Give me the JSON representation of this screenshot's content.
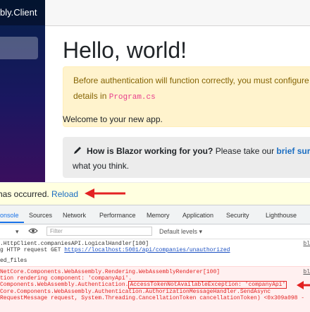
{
  "app": {
    "brand": "bly.Client",
    "heading": "Hello, world!",
    "alert": {
      "line1": "Before authentication will function correctly, you must configure",
      "line2_prefix": "details in",
      "line2_code": "Program.cs"
    },
    "welcome": "Welcome to your new app.",
    "survey": {
      "question": "How is Blazor working for you?",
      "prompt": "Please take our",
      "link": "brief sur",
      "line2": "what you think."
    }
  },
  "error_ui": {
    "message": "has occurred.",
    "reload": "Reload"
  },
  "devtools": {
    "tabs": [
      "onsole",
      "Sources",
      "Network",
      "Performance",
      "Memory",
      "Application",
      "Security",
      "Lighthouse"
    ],
    "active_tab": "onsole",
    "toolbar": {
      "filter_placeholder": "Filter",
      "levels": "Default levels ▾",
      "context": "▾"
    },
    "logs": {
      "info": [
        ".HttpClient.companiesAPI.LogicalHandler[100]",
        "g HTTP request GET",
        "https://localhost:5001/api/companies/unauthorized",
        "ed_files"
      ],
      "info_src": "bl",
      "error": [
        "NetCore.Components.WebAssembly.Rendering.WebAssemblyRenderer[100]",
        "tion rendering component: 'companyApi'.",
        "Components.WebAssembly.Authentication.",
        "AccessTokenNotAvailableException: 'companyApi'",
        "Core.Components.WebAssembly.Authentication.AuthorizationMessageHandler.SendAsync",
        "RequestMessage request, System.Threading.CancellationToken cancellationToken) <0x309a098 -"
      ],
      "error_src": "bl"
    }
  },
  "colors": {
    "accent_link": "#1b6ec2",
    "arrow": "#e32222",
    "alert_bg": "#fff3cd"
  }
}
